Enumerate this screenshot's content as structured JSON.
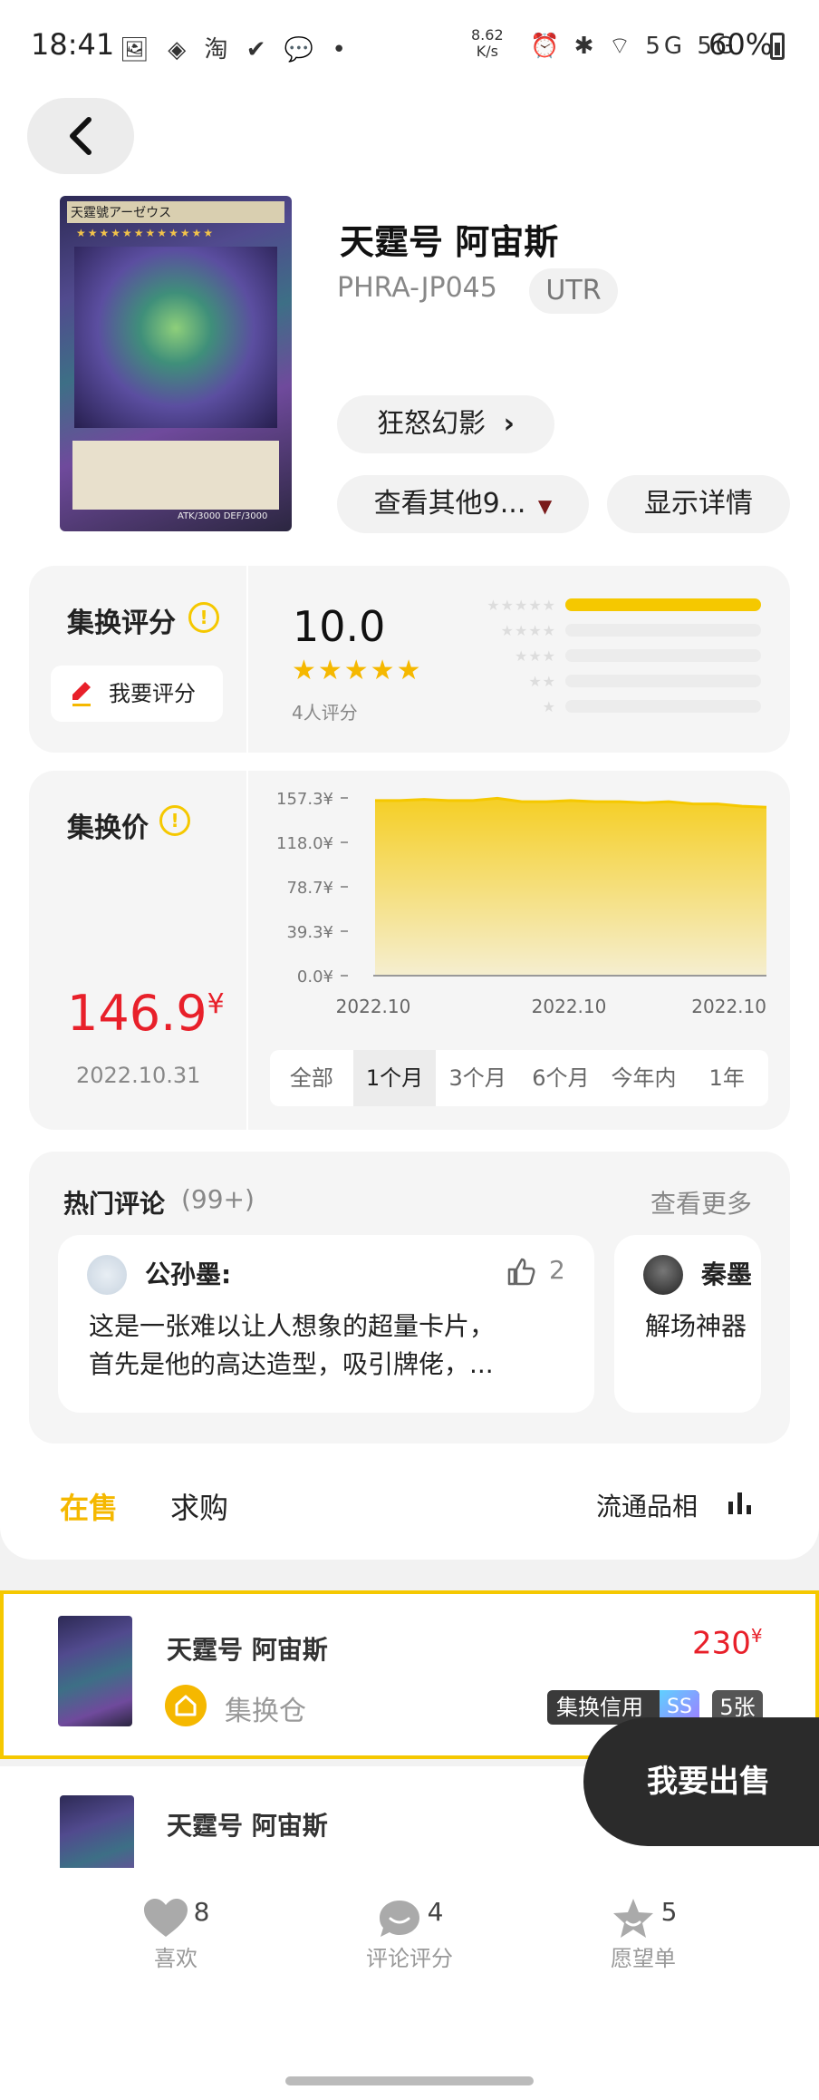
{
  "status_bar": {
    "time": "18:41",
    "left_icons": "🖼 ◈ 淘 ✔ 💬 •",
    "net_speed_value": "8.62",
    "net_speed_unit": "K/s",
    "right_icons": "⏰ ✱ ⌔ 5G 5G",
    "battery": "60%"
  },
  "header": {
    "back_icon": "chevron-left-icon"
  },
  "card": {
    "name": "天霆号 阿宙斯",
    "code": "PHRA-JP045",
    "rarity": "UTR",
    "set_name": "狂怒幻影",
    "other_versions": "查看其他9...",
    "show_details": "显示详情",
    "image_title": "天霆號アーゼウス",
    "image_stats": "ATK/3000 DEF/3000"
  },
  "rating": {
    "label": "集换评分",
    "rate_button": "我要评分",
    "score": "10.0",
    "stars": "★★★★★",
    "count_text": "4人评分",
    "distribution": [
      {
        "stars": 5,
        "fraction": 1.0
      },
      {
        "stars": 4,
        "fraction": 0
      },
      {
        "stars": 3,
        "fraction": 0
      },
      {
        "stars": 2,
        "fraction": 0
      },
      {
        "stars": 1,
        "fraction": 0
      }
    ]
  },
  "price": {
    "label": "集换价",
    "value": "146.9",
    "currency": "¥",
    "date": "2022.10.31",
    "ranges": [
      "全部",
      "1个月",
      "3个月",
      "6个月",
      "今年内",
      "1年"
    ],
    "active_range": "1个月"
  },
  "chart_data": {
    "type": "area",
    "y_ticks": [
      "157.3¥",
      "118.0¥",
      "78.7¥",
      "39.3¥",
      "0.0¥"
    ],
    "ylim": [
      0,
      157.3
    ],
    "x_tick_labels": [
      "2022.10",
      "2022.10",
      "2022.10"
    ],
    "values": [
      155,
      155,
      156,
      155,
      155,
      157,
      154,
      154,
      155,
      154,
      154,
      153,
      154,
      152,
      152,
      150,
      149
    ],
    "color": "#f5c800"
  },
  "comments": {
    "title": "热门评论",
    "count": "(99+)",
    "view_more": "查看更多",
    "items": [
      {
        "author": "公孙墨:",
        "likes": "2",
        "text_line1": "这是一张难以让人想象的超量卡片，",
        "text_line2": "首先是他的高达造型，吸引牌佬，..."
      },
      {
        "author": "秦墨",
        "text_line1": "解场神器"
      }
    ]
  },
  "tabs": {
    "on_sale": "在售",
    "wanted": "求购",
    "circulation": "流通品相"
  },
  "listings": [
    {
      "name": "天霆号 阿宙斯",
      "price": "230",
      "currency": "¥",
      "warehouse": "集换仓",
      "credit": "集换信用",
      "credit_level": "SS",
      "count": "5张"
    },
    {
      "name": "天霆号 阿宙斯"
    }
  ],
  "sell_button": "我要出售",
  "bottom_bar": [
    {
      "icon": "heart-icon",
      "count": "8",
      "label": "喜欢"
    },
    {
      "icon": "comment-icon",
      "count": "4",
      "label": "评论评分"
    },
    {
      "icon": "star-icon",
      "count": "5",
      "label": "愿望单"
    }
  ]
}
